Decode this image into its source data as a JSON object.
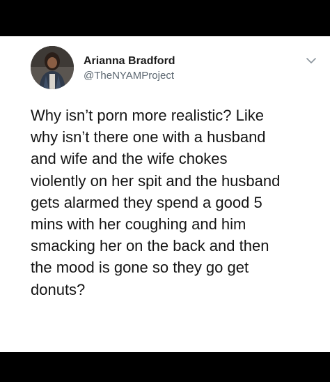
{
  "tweet": {
    "author_name": "Arianna Bradford",
    "author_handle": "@TheNYAMProject",
    "text_lines": [
      "Why isn’t porn more realistic? Like",
      "why isn’t there one with a husband",
      "and wife and the wife chokes",
      "violently on her spit and the husband",
      "gets alarmed they spend a good 5",
      "mins with her coughing and him",
      "smacking her on the back and then",
      "the mood is gone so they go get",
      "donuts?"
    ],
    "menu_icon": "chevron-down-icon",
    "avatar_icon": "user-avatar"
  },
  "colors": {
    "background": "#ffffff",
    "frame": "#000000",
    "name": "#1a1a1a",
    "handle": "#5b6670",
    "text": "#141414"
  }
}
